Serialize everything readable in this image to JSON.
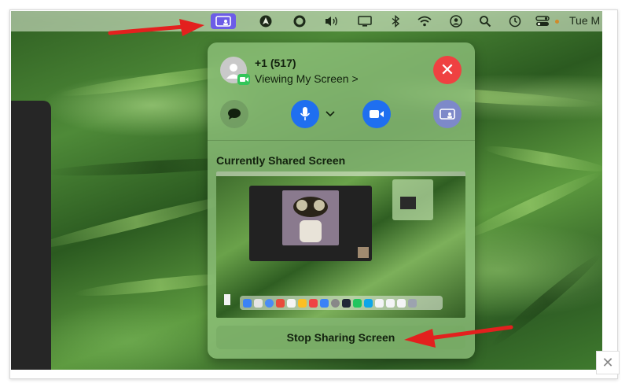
{
  "menubar": {
    "clock_text": "Tue M",
    "icons": [
      "screen-share-icon",
      "navigation-icon",
      "circle-icon",
      "volume-icon",
      "display-icon",
      "bluetooth-icon",
      "wifi-icon",
      "user-icon",
      "search-icon",
      "clock-icon",
      "control-center-icon"
    ]
  },
  "call": {
    "caller": "+1 (517)",
    "status": "Viewing My Screen >"
  },
  "shared": {
    "title": "Currently Shared Screen",
    "stop_label": "Stop Sharing Screen"
  },
  "colors": {
    "accent_purple": "#6c5ce7",
    "end_call_red": "#ef4141",
    "facetime_blue": "#1f6ff0",
    "arrow_red": "#e3201e"
  }
}
